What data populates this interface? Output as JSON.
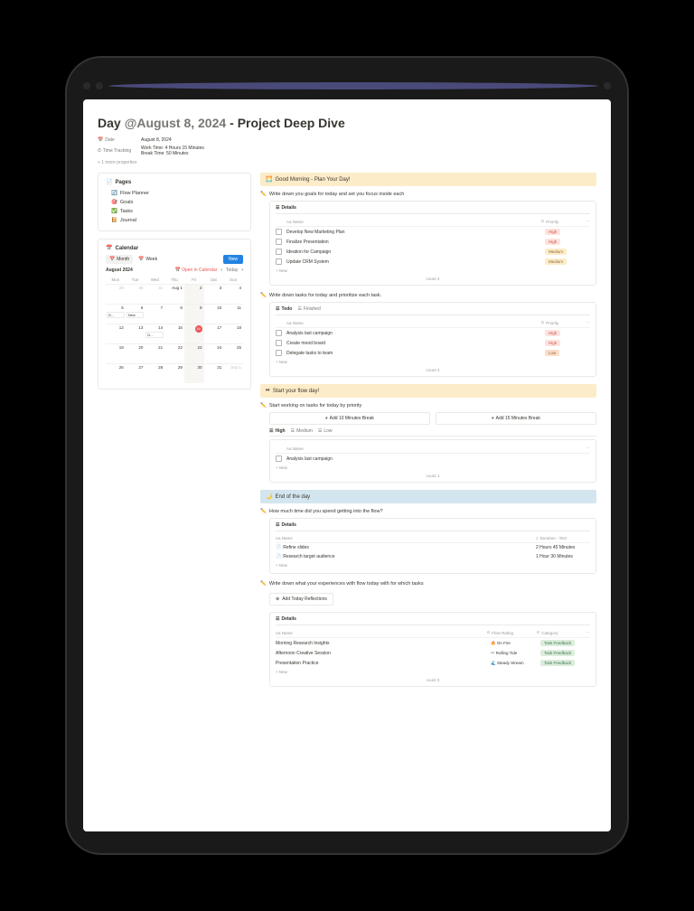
{
  "title": {
    "prefix": "Day ",
    "date": "@August 8, 2024",
    "suffix": " - Project Deep Dive"
  },
  "meta": {
    "date_label": "Date",
    "date_value": "August 8, 2024",
    "track_label": "Time Tracking",
    "track_value1": "Work Time: 4 Hours 15 Minutes",
    "track_value2": "Break Time: 50 Minutes",
    "toggle": "+ 1 more properties"
  },
  "pages": {
    "header": "Pages",
    "items": [
      "Flow Planner",
      "Goals",
      "Tasks",
      "Journal"
    ]
  },
  "calendar": {
    "header": "Calendar",
    "tabs": {
      "month": "Month",
      "week": "Week"
    },
    "new": "New",
    "month_label": "August 2024",
    "open": "Open in Calendar",
    "today": "Today",
    "dow": [
      "Mon",
      "Tue",
      "Wed",
      "Thu",
      "Fri",
      "Sat",
      "Sun"
    ],
    "event1": "D...",
    "event2": "D...",
    "event3": "New"
  },
  "morning": {
    "bar": "Good Morning - Plan Your Day!",
    "goals_line": "Write down you goals for today and set you focus inside each",
    "details_tab": "Details",
    "col_name": "Aa Name",
    "col_prio": "Priority",
    "goals": [
      {
        "name": "Develop New Marketing Plan",
        "prio": "High",
        "cls": "tag-high"
      },
      {
        "name": "Finalize Presentation",
        "prio": "High",
        "cls": "tag-high"
      },
      {
        "name": "Ideation for Campaign",
        "prio": "Medium",
        "cls": "tag-med"
      },
      {
        "name": "Update CRM System",
        "prio": "Medium",
        "cls": "tag-med"
      }
    ],
    "count1": "count 4",
    "tasks_line": "Write down tasks for today and prioritize each task.",
    "todo_tab": "Todo",
    "done_tab": "Finished",
    "tasks": [
      {
        "name": "Analysis last campaign",
        "prio": "High",
        "cls": "tag-high"
      },
      {
        "name": "Create mood board",
        "prio": "High",
        "cls": "tag-high"
      },
      {
        "name": "Delegate tasks to team",
        "prio": "Low",
        "cls": "tag-low"
      }
    ],
    "count2": "count 3",
    "new_row": "+ New"
  },
  "flow": {
    "bar": "Start your flow day!",
    "line": "Start working on tasks for today by priority",
    "break10": "Add 10 Minutes Break",
    "break15": "Add 15 Minutes Break",
    "tabs": {
      "high": "High",
      "med": "Medium",
      "low": "Low"
    },
    "col_name": "Aa Name",
    "rows": [
      {
        "name": "Analysis last campaign"
      }
    ],
    "count": "count 1"
  },
  "end": {
    "bar": "End of the day",
    "q1": "How much time did you spend getting into the flow?",
    "details": "Details",
    "col_name": "Aa Name",
    "col_dur": "Duration - Text",
    "rows": [
      {
        "name": "Refine slides",
        "dur": "2 Hours 45 Minutes"
      },
      {
        "name": "Research target audience",
        "dur": "1 Hour 30 Minutes"
      }
    ],
    "q2": "Write down what your experiences with flow today with for which tasks",
    "reflect_btn": "Add Today Reflections",
    "col_flow": "Flow Rating",
    "col_cat": "Category",
    "reflections": [
      {
        "name": "Morning Research Insights",
        "flow": "🔥 On Fire",
        "cat": "Task Feedback"
      },
      {
        "name": "Afternoon Creative Session",
        "flow": "〰 Rolling Tide",
        "cat": "Task Feedback"
      },
      {
        "name": "Presentation Practice",
        "flow": "🌊 Steady Stream",
        "cat": "Task Feedback"
      }
    ],
    "count": "count 3"
  }
}
